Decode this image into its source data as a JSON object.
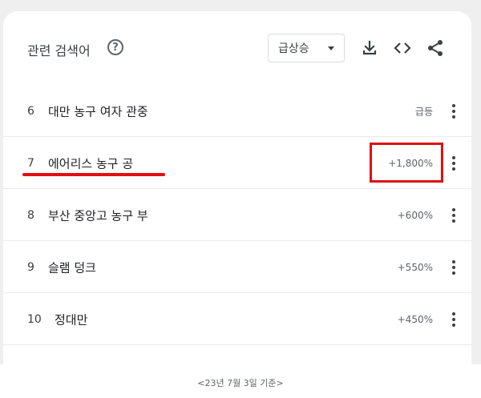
{
  "header": {
    "title": "관련 검색어",
    "dropdown_label": "급상승"
  },
  "icons": {
    "help": "help-circle-icon",
    "caret": "caret-down-icon",
    "download": "download-icon",
    "embed": "code-icon",
    "share": "share-icon",
    "more": "more-vert-icon"
  },
  "rows": [
    {
      "rank": "6",
      "query": "대만 농구 여자 관중",
      "value": "급등"
    },
    {
      "rank": "7",
      "query": "에어리스 농구 공",
      "value": "+1,800%"
    },
    {
      "rank": "8",
      "query": "부산 중앙고 농구 부",
      "value": "+600%"
    },
    {
      "rank": "9",
      "query": "슬램 덩크",
      "value": "+550%"
    },
    {
      "rank": "10",
      "query": "정대만",
      "value": "+450%"
    }
  ],
  "annotation_color": "#e20f10",
  "caption": "<23년 7월 3일 기준>"
}
